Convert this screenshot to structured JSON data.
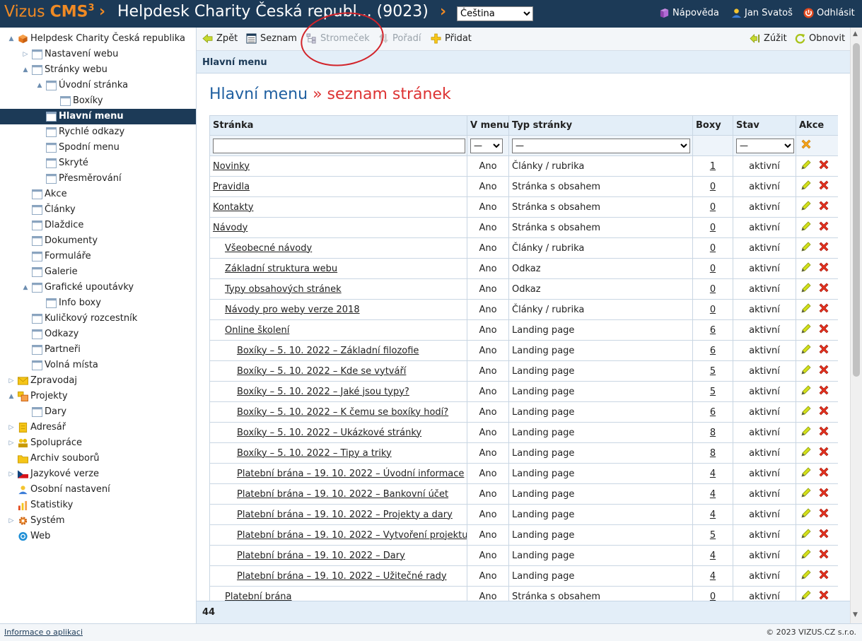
{
  "topbar": {
    "brand_plain": "Vizus ",
    "brand_bold": "CMS",
    "brand_sup": "3",
    "site_name": "Helpdesk Charity Česká republ...  (9023)",
    "language": "Čeština",
    "help": "Nápověda",
    "user": "Jan Svatoš",
    "logout": "Odhlásit"
  },
  "sidebar": {
    "items": [
      {
        "label": "Helpdesk Charity Česká republika",
        "level": 0,
        "twisty": "▲",
        "icon": "cube-icon"
      },
      {
        "label": "Nastavení webu",
        "level": 1,
        "twisty": "▷",
        "icon": "page-icon"
      },
      {
        "label": "Stránky webu",
        "level": 1,
        "twisty": "▲",
        "icon": "page-icon"
      },
      {
        "label": "Úvodní stránka",
        "level": 2,
        "twisty": "▲",
        "icon": "page-icon"
      },
      {
        "label": "Boxíky",
        "level": 3,
        "twisty": "",
        "icon": "page-icon"
      },
      {
        "label": "Hlavní menu",
        "level": 2,
        "twisty": "",
        "icon": "page-icon",
        "selected": true
      },
      {
        "label": "Rychlé odkazy",
        "level": 2,
        "twisty": "",
        "icon": "page-icon"
      },
      {
        "label": "Spodní menu",
        "level": 2,
        "twisty": "",
        "icon": "page-icon"
      },
      {
        "label": "Skryté",
        "level": 2,
        "twisty": "",
        "icon": "page-icon"
      },
      {
        "label": "Přesměrování",
        "level": 2,
        "twisty": "",
        "icon": "page-icon"
      },
      {
        "label": "Akce",
        "level": 1,
        "twisty": "",
        "icon": "page-icon"
      },
      {
        "label": "Články",
        "level": 1,
        "twisty": "",
        "icon": "page-icon"
      },
      {
        "label": "Dlaždice",
        "level": 1,
        "twisty": "",
        "icon": "page-icon"
      },
      {
        "label": "Dokumenty",
        "level": 1,
        "twisty": "",
        "icon": "page-icon"
      },
      {
        "label": "Formuláře",
        "level": 1,
        "twisty": "",
        "icon": "page-icon"
      },
      {
        "label": "Galerie",
        "level": 1,
        "twisty": "",
        "icon": "page-icon"
      },
      {
        "label": "Grafické upoutávky",
        "level": 1,
        "twisty": "▲",
        "icon": "page-icon"
      },
      {
        "label": "Info boxy",
        "level": 2,
        "twisty": "",
        "icon": "page-icon"
      },
      {
        "label": "Kuličkový rozcestník",
        "level": 1,
        "twisty": "",
        "icon": "page-icon"
      },
      {
        "label": "Odkazy",
        "level": 1,
        "twisty": "",
        "icon": "page-icon"
      },
      {
        "label": "Partneři",
        "level": 1,
        "twisty": "",
        "icon": "page-icon"
      },
      {
        "label": "Volná místa",
        "level": 1,
        "twisty": "",
        "icon": "page-icon"
      },
      {
        "label": "Zpravodaj",
        "level": 0,
        "twisty": "▷",
        "icon": "envelope-icon"
      },
      {
        "label": "Projekty",
        "level": 0,
        "twisty": "▲",
        "icon": "projects-icon"
      },
      {
        "label": "Dary",
        "level": 1,
        "twisty": "",
        "icon": "page-icon"
      },
      {
        "label": "Adresář",
        "level": 0,
        "twisty": "▷",
        "icon": "address-book-icon"
      },
      {
        "label": "Spolupráce",
        "level": 0,
        "twisty": "▷",
        "icon": "cooperation-icon"
      },
      {
        "label": "Archiv souborů",
        "level": 0,
        "twisty": "",
        "icon": "archive-icon"
      },
      {
        "label": "Jazykové verze",
        "level": 0,
        "twisty": "▷",
        "icon": "czech-flag-icon"
      },
      {
        "label": "Osobní nastavení",
        "level": 0,
        "twisty": "",
        "icon": "user-icon"
      },
      {
        "label": "Statistiky",
        "level": 0,
        "twisty": "",
        "icon": "statistics-icon"
      },
      {
        "label": "Systém",
        "level": 0,
        "twisty": "▷",
        "icon": "gear-icon"
      },
      {
        "label": "Web",
        "level": 0,
        "twisty": "",
        "icon": "web-icon"
      }
    ]
  },
  "toolbar": {
    "back": "Zpět",
    "list": "Seznam",
    "tree": "Stromeček",
    "order": "Pořadí",
    "add": "Přidat",
    "narrow": "Zúžit",
    "refresh": "Obnovit"
  },
  "breadcrumb": "Hlavní menu",
  "heading": {
    "title": "Hlavní menu",
    "separator": "»",
    "subtitle": "seznam stránek"
  },
  "table": {
    "columns": [
      "Stránka",
      "V menu",
      "Typ stránky",
      "Boxy",
      "Stav",
      "Akce"
    ],
    "filter": {
      "in_menu": "—",
      "type": "—",
      "state": "—"
    },
    "rows": [
      {
        "page": "Novinky",
        "indent": 0,
        "in_menu": "Ano",
        "type": "Články / rubrika",
        "boxes": "1",
        "state": "aktivní"
      },
      {
        "page": "Pravidla",
        "indent": 0,
        "in_menu": "Ano",
        "type": "Stránka s obsahem",
        "boxes": "0",
        "state": "aktivní"
      },
      {
        "page": "Kontakty",
        "indent": 0,
        "in_menu": "Ano",
        "type": "Stránka s obsahem",
        "boxes": "0",
        "state": "aktivní"
      },
      {
        "page": "Návody",
        "indent": 0,
        "in_menu": "Ano",
        "type": "Stránka s obsahem",
        "boxes": "0",
        "state": "aktivní"
      },
      {
        "page": "Všeobecné návody",
        "indent": 1,
        "in_menu": "Ano",
        "type": "Články / rubrika",
        "boxes": "0",
        "state": "aktivní"
      },
      {
        "page": "Základní struktura webu",
        "indent": 1,
        "in_menu": "Ano",
        "type": "Odkaz",
        "boxes": "0",
        "state": "aktivní"
      },
      {
        "page": "Typy obsahových stránek",
        "indent": 1,
        "in_menu": "Ano",
        "type": "Odkaz",
        "boxes": "0",
        "state": "aktivní"
      },
      {
        "page": "Návody pro weby verze 2018",
        "indent": 1,
        "in_menu": "Ano",
        "type": "Články / rubrika",
        "boxes": "0",
        "state": "aktivní"
      },
      {
        "page": "Online školení",
        "indent": 1,
        "in_menu": "Ano",
        "type": "Landing page",
        "boxes": "6",
        "state": "aktivní"
      },
      {
        "page": "Boxíky – 5. 10. 2022 – Základní filozofie",
        "indent": 2,
        "in_menu": "Ano",
        "type": "Landing page",
        "boxes": "6",
        "state": "aktivní"
      },
      {
        "page": "Boxíky – 5. 10. 2022 – Kde se vytváří",
        "indent": 2,
        "in_menu": "Ano",
        "type": "Landing page",
        "boxes": "5",
        "state": "aktivní"
      },
      {
        "page": "Boxíky – 5. 10. 2022 – Jaké jsou typy?",
        "indent": 2,
        "in_menu": "Ano",
        "type": "Landing page",
        "boxes": "5",
        "state": "aktivní"
      },
      {
        "page": "Boxíky – 5. 10. 2022 – K čemu se boxíky hodí?",
        "indent": 2,
        "in_menu": "Ano",
        "type": "Landing page",
        "boxes": "6",
        "state": "aktivní"
      },
      {
        "page": "Boxíky – 5. 10. 2022 – Ukázkové stránky",
        "indent": 2,
        "in_menu": "Ano",
        "type": "Landing page",
        "boxes": "8",
        "state": "aktivní"
      },
      {
        "page": "Boxíky – 5. 10. 2022 – Tipy a triky",
        "indent": 2,
        "in_menu": "Ano",
        "type": "Landing page",
        "boxes": "8",
        "state": "aktivní"
      },
      {
        "page": "Platební brána – 19. 10. 2022 – Úvodní informace",
        "indent": 2,
        "in_menu": "Ano",
        "type": "Landing page",
        "boxes": "4",
        "state": "aktivní"
      },
      {
        "page": "Platební brána – 19. 10. 2022 – Bankovní účet",
        "indent": 2,
        "in_menu": "Ano",
        "type": "Landing page",
        "boxes": "4",
        "state": "aktivní"
      },
      {
        "page": "Platební brána – 19. 10. 2022 – Projekty a dary",
        "indent": 2,
        "in_menu": "Ano",
        "type": "Landing page",
        "boxes": "4",
        "state": "aktivní"
      },
      {
        "page": "Platební brána – 19. 10. 2022 – Vytvoření projektu",
        "indent": 2,
        "in_menu": "Ano",
        "type": "Landing page",
        "boxes": "5",
        "state": "aktivní"
      },
      {
        "page": "Platební brána – 19. 10. 2022 – Dary",
        "indent": 2,
        "in_menu": "Ano",
        "type": "Landing page",
        "boxes": "4",
        "state": "aktivní"
      },
      {
        "page": "Platební brána – 19. 10. 2022 – Užitečné rady",
        "indent": 2,
        "in_menu": "Ano",
        "type": "Landing page",
        "boxes": "4",
        "state": "aktivní"
      },
      {
        "page": "Platební brána",
        "indent": 1,
        "in_menu": "Ano",
        "type": "Stránka s obsahem",
        "boxes": "0",
        "state": "aktivní"
      }
    ]
  },
  "footer": {
    "count": "44"
  },
  "statusbar": {
    "info_link": "Informace o aplikaci",
    "copyright": "© 2023 VIZUS.CZ s.r.o."
  },
  "colors": {
    "header_bg": "#1c3a57",
    "brand_orange": "#f08a24",
    "selected_bg": "#1c3a57",
    "heading_blue": "#1f5fa0",
    "accent_red": "#d33",
    "annotation_red": "#d2232a"
  }
}
